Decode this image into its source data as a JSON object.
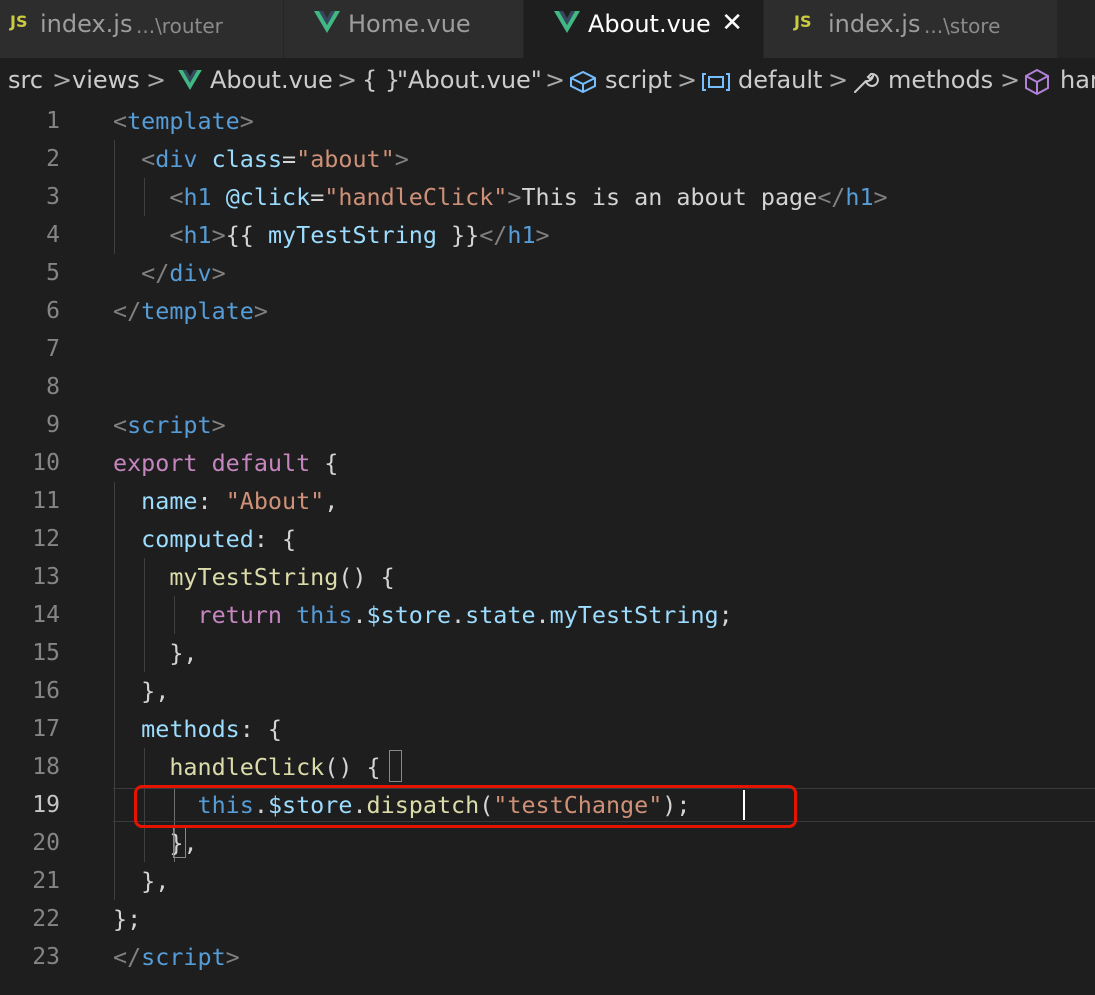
{
  "tabs": [
    {
      "icon": "JS",
      "name": "index.js",
      "hint": "...\\router"
    },
    {
      "icon": "vue",
      "name": "Home.vue",
      "hint": ""
    },
    {
      "icon": "vue",
      "name": "About.vue",
      "hint": "",
      "close": "✕"
    },
    {
      "icon": "JS",
      "name": "index.js",
      "hint": "...\\store"
    }
  ],
  "breadcrumb": {
    "items": [
      "src",
      "views",
      "About.vue",
      "{ }",
      "\"About.vue\"",
      "script",
      "default",
      "methods",
      "handleClick"
    ],
    "separator": ">"
  },
  "editor": {
    "line_numbers": [
      "1",
      "2",
      "3",
      "4",
      "5",
      "6",
      "7",
      "8",
      "9",
      "10",
      "11",
      "12",
      "13",
      "14",
      "15",
      "16",
      "17",
      "18",
      "19",
      "20",
      "21",
      "22",
      "23"
    ],
    "current_line": 19
  },
  "code": {
    "l1": [
      "<",
      "template",
      ">"
    ],
    "l2": [
      "<",
      "div",
      "class",
      "=",
      "\"about\"",
      ">"
    ],
    "l3": [
      "<",
      "h1",
      "@click",
      "=",
      "\"handleClick\"",
      ">",
      "This is an about page",
      "</",
      "h1",
      ">"
    ],
    "l4": [
      "<",
      "h1",
      ">",
      "{{ ",
      "myTestString",
      " }}",
      "</",
      "h1",
      ">"
    ],
    "l5": [
      "</",
      "div",
      ">"
    ],
    "l6": [
      "</",
      "template",
      ">"
    ],
    "l9": [
      "<",
      "script",
      ">"
    ],
    "l10": [
      "export",
      "default",
      "{"
    ],
    "l11": [
      "name",
      ": ",
      "\"About\"",
      ","
    ],
    "l12": [
      "computed",
      ": {"
    ],
    "l13": [
      "myTestString",
      "() {"
    ],
    "l14": [
      "return",
      "this",
      ".",
      "$store",
      ".",
      "state",
      ".",
      "myTestString",
      ";"
    ],
    "l15": [
      "},"
    ],
    "l16": [
      "},"
    ],
    "l17": [
      "methods",
      ": {"
    ],
    "l18": [
      "handleClick",
      "() ",
      "{"
    ],
    "l19": [
      "this",
      ".",
      "$store",
      ".",
      "dispatch",
      "(",
      "\"testChange\"",
      ");"
    ],
    "l20": [
      "}",
      ","
    ],
    "l21": [
      "},"
    ],
    "l22": [
      "};"
    ],
    "l23": [
      "</",
      "script",
      ">"
    ]
  },
  "colors": {
    "background": "#1e1e1e",
    "tag_bracket": "#808080",
    "tag_name": "#569cd6",
    "attribute": "#9cdcfe",
    "string": "#ce9178",
    "keyword": "#c586c0",
    "function": "#dcdcaa",
    "highlight_box": "#e51400",
    "vue_green": "#41b883"
  }
}
